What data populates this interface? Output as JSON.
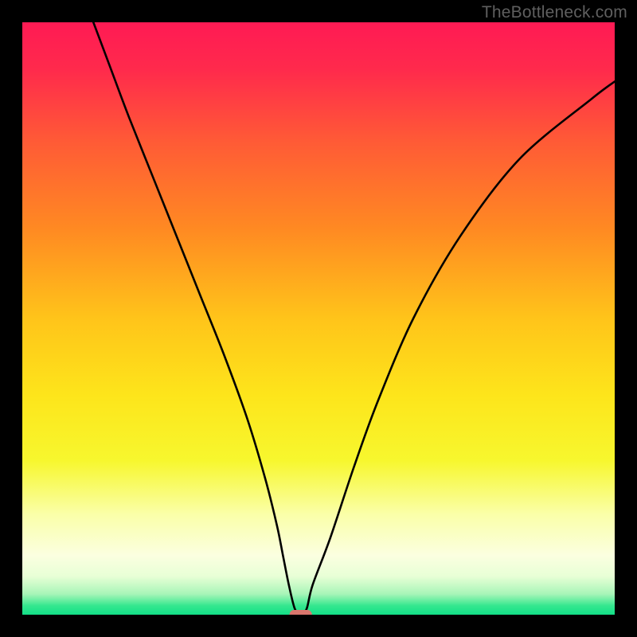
{
  "attribution": "TheBottleneck.com",
  "chart_data": {
    "type": "line",
    "title": "",
    "xlabel": "",
    "ylabel": "",
    "xlim": [
      0,
      100
    ],
    "ylim": [
      0,
      100
    ],
    "grid": false,
    "series": [
      {
        "name": "curve",
        "x": [
          12,
          15,
          18,
          22,
          26,
          30,
          34,
          38,
          41,
          43,
          44,
          45,
          46,
          47,
          48,
          49,
          52,
          56,
          60,
          66,
          74,
          84,
          96,
          100
        ],
        "values": [
          100,
          92,
          84,
          74,
          64,
          54,
          44,
          33,
          23,
          15,
          10,
          5,
          1,
          0,
          1,
          5,
          13,
          25,
          36,
          50,
          64,
          77,
          87,
          90
        ]
      }
    ],
    "marker": {
      "x": 47,
      "y": 0,
      "width_pct": 3.8,
      "height_pct": 1.6,
      "color": "#d9766d"
    },
    "gradient_stops": [
      {
        "offset": 0,
        "color": "#ff1a54"
      },
      {
        "offset": 0.08,
        "color": "#ff2a4c"
      },
      {
        "offset": 0.2,
        "color": "#ff5a36"
      },
      {
        "offset": 0.35,
        "color": "#ff8a22"
      },
      {
        "offset": 0.5,
        "color": "#ffc41a"
      },
      {
        "offset": 0.63,
        "color": "#fde51b"
      },
      {
        "offset": 0.74,
        "color": "#f7f72e"
      },
      {
        "offset": 0.83,
        "color": "#faffa8"
      },
      {
        "offset": 0.9,
        "color": "#fbffe0"
      },
      {
        "offset": 0.935,
        "color": "#e8ffd6"
      },
      {
        "offset": 0.965,
        "color": "#a8f5b8"
      },
      {
        "offset": 0.985,
        "color": "#34e78e"
      },
      {
        "offset": 1.0,
        "color": "#12df88"
      }
    ]
  }
}
